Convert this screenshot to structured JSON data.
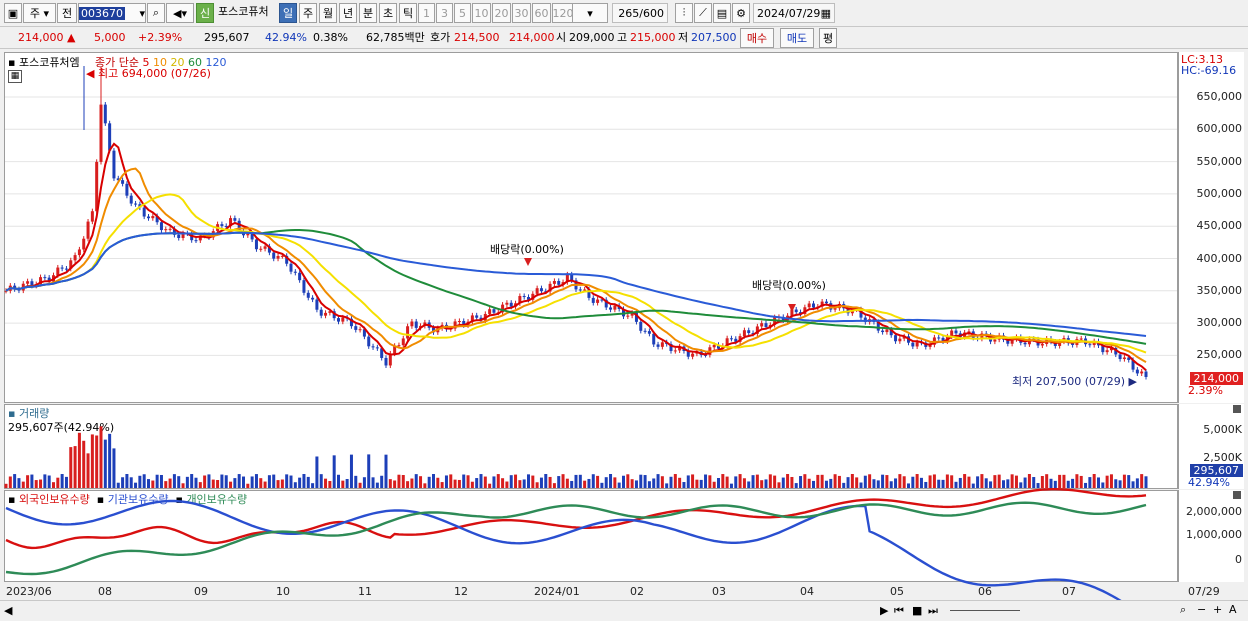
{
  "toolbar": {
    "market": "주",
    "item_type": "전",
    "code": "003670",
    "credit": "신",
    "name": "포스코퓨처",
    "periods": [
      "일",
      "주",
      "월",
      "년",
      "분",
      "초",
      "틱"
    ],
    "active_period": "일",
    "nums": [
      "1",
      "3",
      "5",
      "10",
      "20",
      "30",
      "60",
      "120"
    ],
    "count": "265",
    "count_total": "/600",
    "date": "2024/07/29"
  },
  "quote": {
    "price": "214,000",
    "change": "5,000",
    "rate": "+2.39%",
    "volume": "295,607",
    "vol_ratio": "42.94%",
    "turnover": "0.38%",
    "amount": "62,785백만",
    "bid_label": "호가",
    "ask": "214,500",
    "bid": "214,000",
    "open_label": "시",
    "open": "209,000",
    "high_label": "고",
    "high": "215,000",
    "low_label": "저",
    "low": "207,500",
    "buy": "매수",
    "sell": "매도",
    "eval": "평"
  },
  "price_panel": {
    "name": "포스코퓨처엠",
    "ma_title": "종가 단순",
    "ma_periods": [
      "5",
      "10",
      "20",
      "60",
      "120"
    ],
    "ma_colors": [
      "#d80000",
      "#f08c00",
      "#f5e000",
      "#1f8c3a",
      "#2a5bd7"
    ],
    "lc": "LC:3.13",
    "hc": "HC:-69.16",
    "high_label": "최고 694,000 (07/26)",
    "low_label": "최저 207,500 (07/29)",
    "div1": "배당락(0.00%)",
    "div2": "배당락(0.00%)",
    "last_price": "214,000",
    "last_rate": "2.39%",
    "yticks": [
      "650,000",
      "600,000",
      "550,000",
      "500,000",
      "450,000",
      "400,000",
      "350,000",
      "300,000",
      "250,000"
    ]
  },
  "volume_panel": {
    "title": "거래량",
    "value": "295,607주(42.94%)",
    "yticks": [
      "5,000K",
      "2,500K"
    ],
    "last": "295,607",
    "last_rate": "42.94%"
  },
  "holder_panel": {
    "series": [
      "외국인보유수량",
      "기관보유수량",
      "개인보유수량"
    ],
    "colors": [
      "#d81010",
      "#2a4fd0",
      "#2e8b57"
    ],
    "yticks": [
      "2,000,000",
      "1,000,000",
      "0"
    ]
  },
  "xaxis": [
    "2023/06",
    "08",
    "09",
    "10",
    "11",
    "12",
    "2024/01",
    "02",
    "03",
    "04",
    "05",
    "06",
    "07"
  ],
  "xaxis_end": "07/29"
}
